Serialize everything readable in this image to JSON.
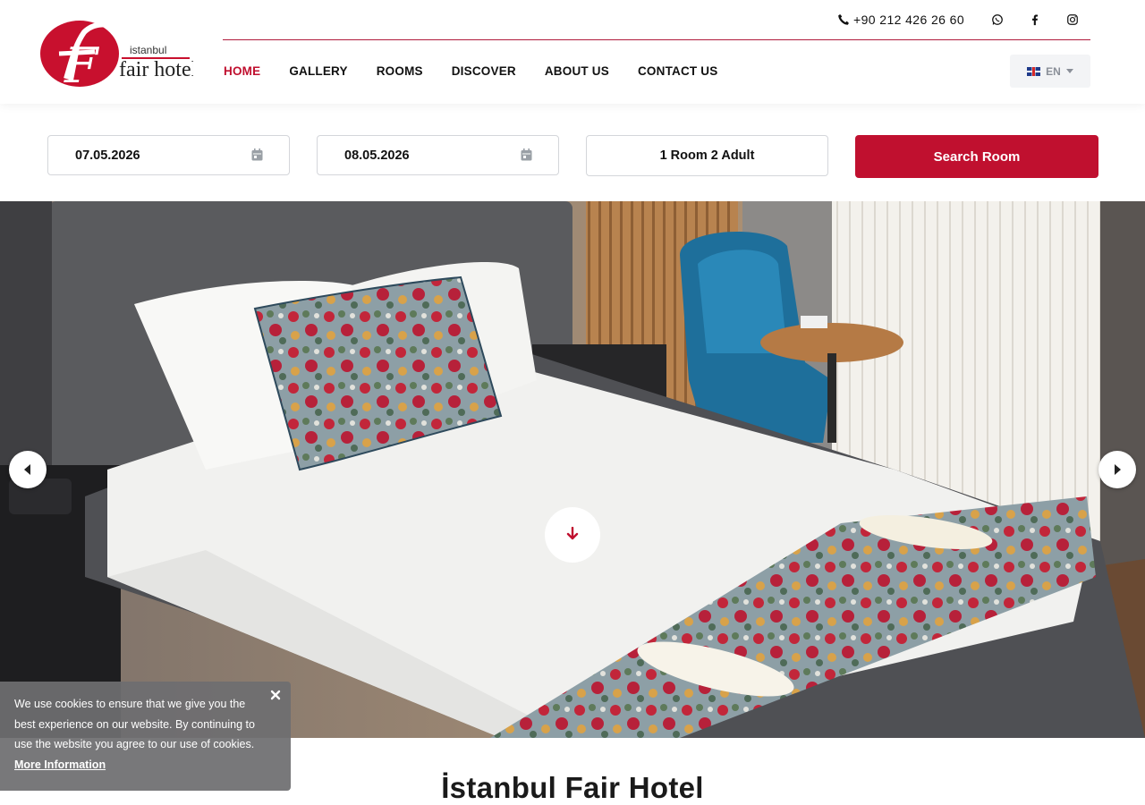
{
  "brand": {
    "logo_letter": "F",
    "logo_city": "istanbul",
    "logo_name": "fair hotel",
    "brand_color": "#c0102f"
  },
  "header": {
    "phone": "+90 212 426 26 60",
    "social": [
      "whatsapp-icon",
      "facebook-icon",
      "instagram-icon"
    ],
    "nav": [
      {
        "label": "HOME",
        "active": true
      },
      {
        "label": "GALLERY",
        "active": false
      },
      {
        "label": "ROOMS",
        "active": false
      },
      {
        "label": "DISCOVER",
        "active": false
      },
      {
        "label": "ABOUT US",
        "active": false
      },
      {
        "label": "CONTACT US",
        "active": false
      }
    ],
    "language": "EN"
  },
  "booking": {
    "checkin": "07.05.2026",
    "checkout": "08.05.2026",
    "guests": "1 Room 2 Adult",
    "search_label": "Search Room"
  },
  "hero": {
    "image_subject": "hotel bedroom with white bed, floral pillow and runner, blue armchair, round side table"
  },
  "main": {
    "title": "İstanbul Fair Hotel"
  },
  "cookie": {
    "text": "We use cookies to ensure that we give you the best experience on our website. By continuing to use the website you agree to our use of cookies.",
    "link_label": "More Information"
  }
}
